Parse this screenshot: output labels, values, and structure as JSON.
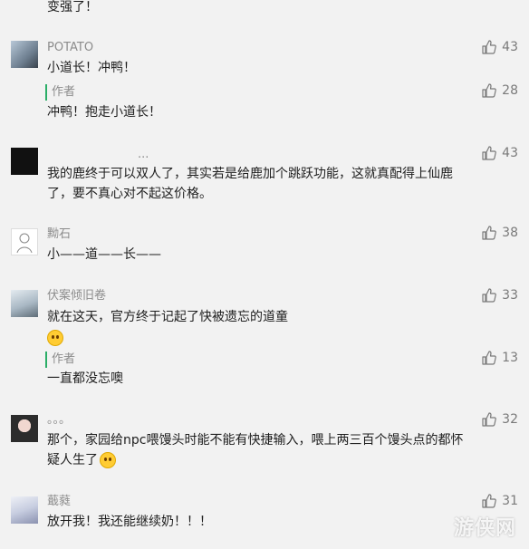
{
  "top_text": "变强了！",
  "comments": [
    {
      "name": "POTATO",
      "text": "小道长！冲鸭！",
      "likes": "43",
      "reply": {
        "author": "作者",
        "text": "冲鸭！抱走小道长！",
        "likes": "28"
      }
    },
    {
      "name": "...",
      "text1": "我的鹿终于可以双人了，其实若是给鹿加个跳跃功能，这就真配得上仙鹿",
      "text2": "了，要不真心对不起这价格。",
      "likes": "43"
    },
    {
      "name": "黝石",
      "text": "小——道——长——",
      "likes": "38"
    },
    {
      "name": "伏案倾旧卷",
      "text": "就在这天，官方终于记起了快被遗忘的道童",
      "likes": "33",
      "reply": {
        "author": "作者",
        "text": "一直都没忘噢",
        "likes": "13"
      }
    },
    {
      "name": "。。。",
      "text1": "那个，家园给npc喂馒头时能不能有快捷输入，喂上两三百个馒头点的都怀",
      "text2": "疑人生了",
      "likes": "32"
    },
    {
      "name": "蕺蕤",
      "text": "放开我！我还能继续奶！！！",
      "likes": "31"
    }
  ],
  "watermark": "游侠网",
  "icons": {
    "like": "thumbs-up-icon"
  }
}
